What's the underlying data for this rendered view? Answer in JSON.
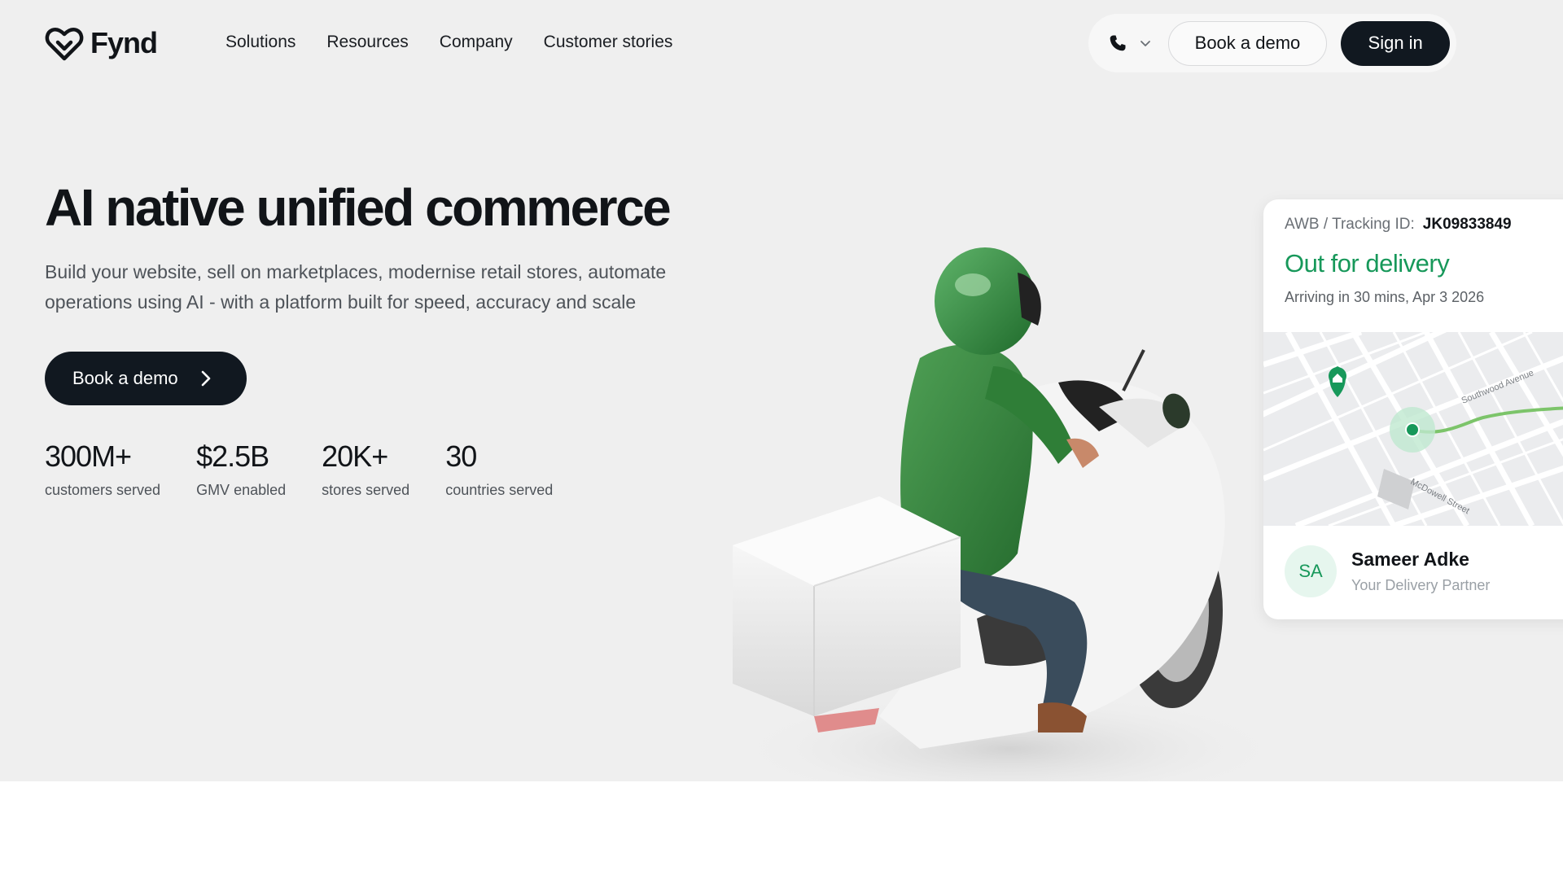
{
  "brand": {
    "name": "Fynd"
  },
  "nav": {
    "links": [
      "Solutions",
      "Resources",
      "Company",
      "Customer stories"
    ],
    "book_demo_label": "Book a demo",
    "sign_in_label": "Sign in"
  },
  "hero": {
    "headline": "AI native unified commerce",
    "subtext": "Build your website, sell on marketplaces, modernise retail stores, automate operations using AI - with a platform built for speed, accuracy and scale",
    "cta_label": "Book a demo",
    "stats": [
      {
        "value": "300M+",
        "label": "customers served"
      },
      {
        "value": "$2.5B",
        "label": "GMV enabled"
      },
      {
        "value": "20K+",
        "label": "stores served"
      },
      {
        "value": "30",
        "label": "countries served"
      }
    ]
  },
  "tracking_card": {
    "id_label": "AWB / Tracking ID:",
    "id_value": "JK09833849",
    "status": "Out for delivery",
    "eta": "Arriving in 30 mins, Apr 3 2026",
    "map_streets": [
      "Southwood Avenue",
      "McDowell Street"
    ],
    "partner_initials": "SA",
    "partner_name": "Sameer Adke",
    "partner_role": "Your Delivery Partner"
  },
  "colors": {
    "accent_green": "#17985a",
    "dark_button": "#111820",
    "hero_bg": "#efefef"
  },
  "icons": [
    "fynd-logo-icon",
    "phone-icon",
    "chevron-down-icon",
    "chevron-right-icon",
    "location-pin-icon"
  ]
}
